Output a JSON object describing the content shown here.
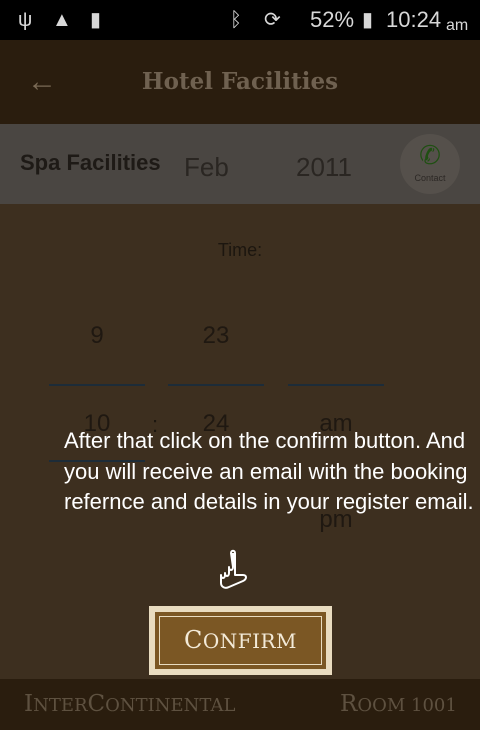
{
  "status": {
    "battery_text": "52%",
    "time": "10:24",
    "ampm": "am"
  },
  "appbar": {
    "title": "Hotel Facilities"
  },
  "subheader": {
    "title": "Spa Facilities",
    "month": "Feb",
    "year": "2011",
    "contact_label": "Contact"
  },
  "time_picker": {
    "label": "Time:",
    "hour_prev": "9",
    "minute_prev": "23",
    "hour": "10",
    "colon": ":",
    "minute": "24",
    "period": "am",
    "period_next": "pm"
  },
  "overlay": {
    "instruction": "After that click on the confirm button. And you will receive an email with the booking refernce and details in your register email."
  },
  "confirm": {
    "label_first": "C",
    "label_rest": "ONFIRM"
  },
  "footer": {
    "brand_i": "I",
    "brand_nter": "NTER",
    "brand_c": "C",
    "brand_ontinental": "ONTINENTAL",
    "room_r": "R",
    "room_oom": "OOM",
    "room_number": "1001"
  }
}
